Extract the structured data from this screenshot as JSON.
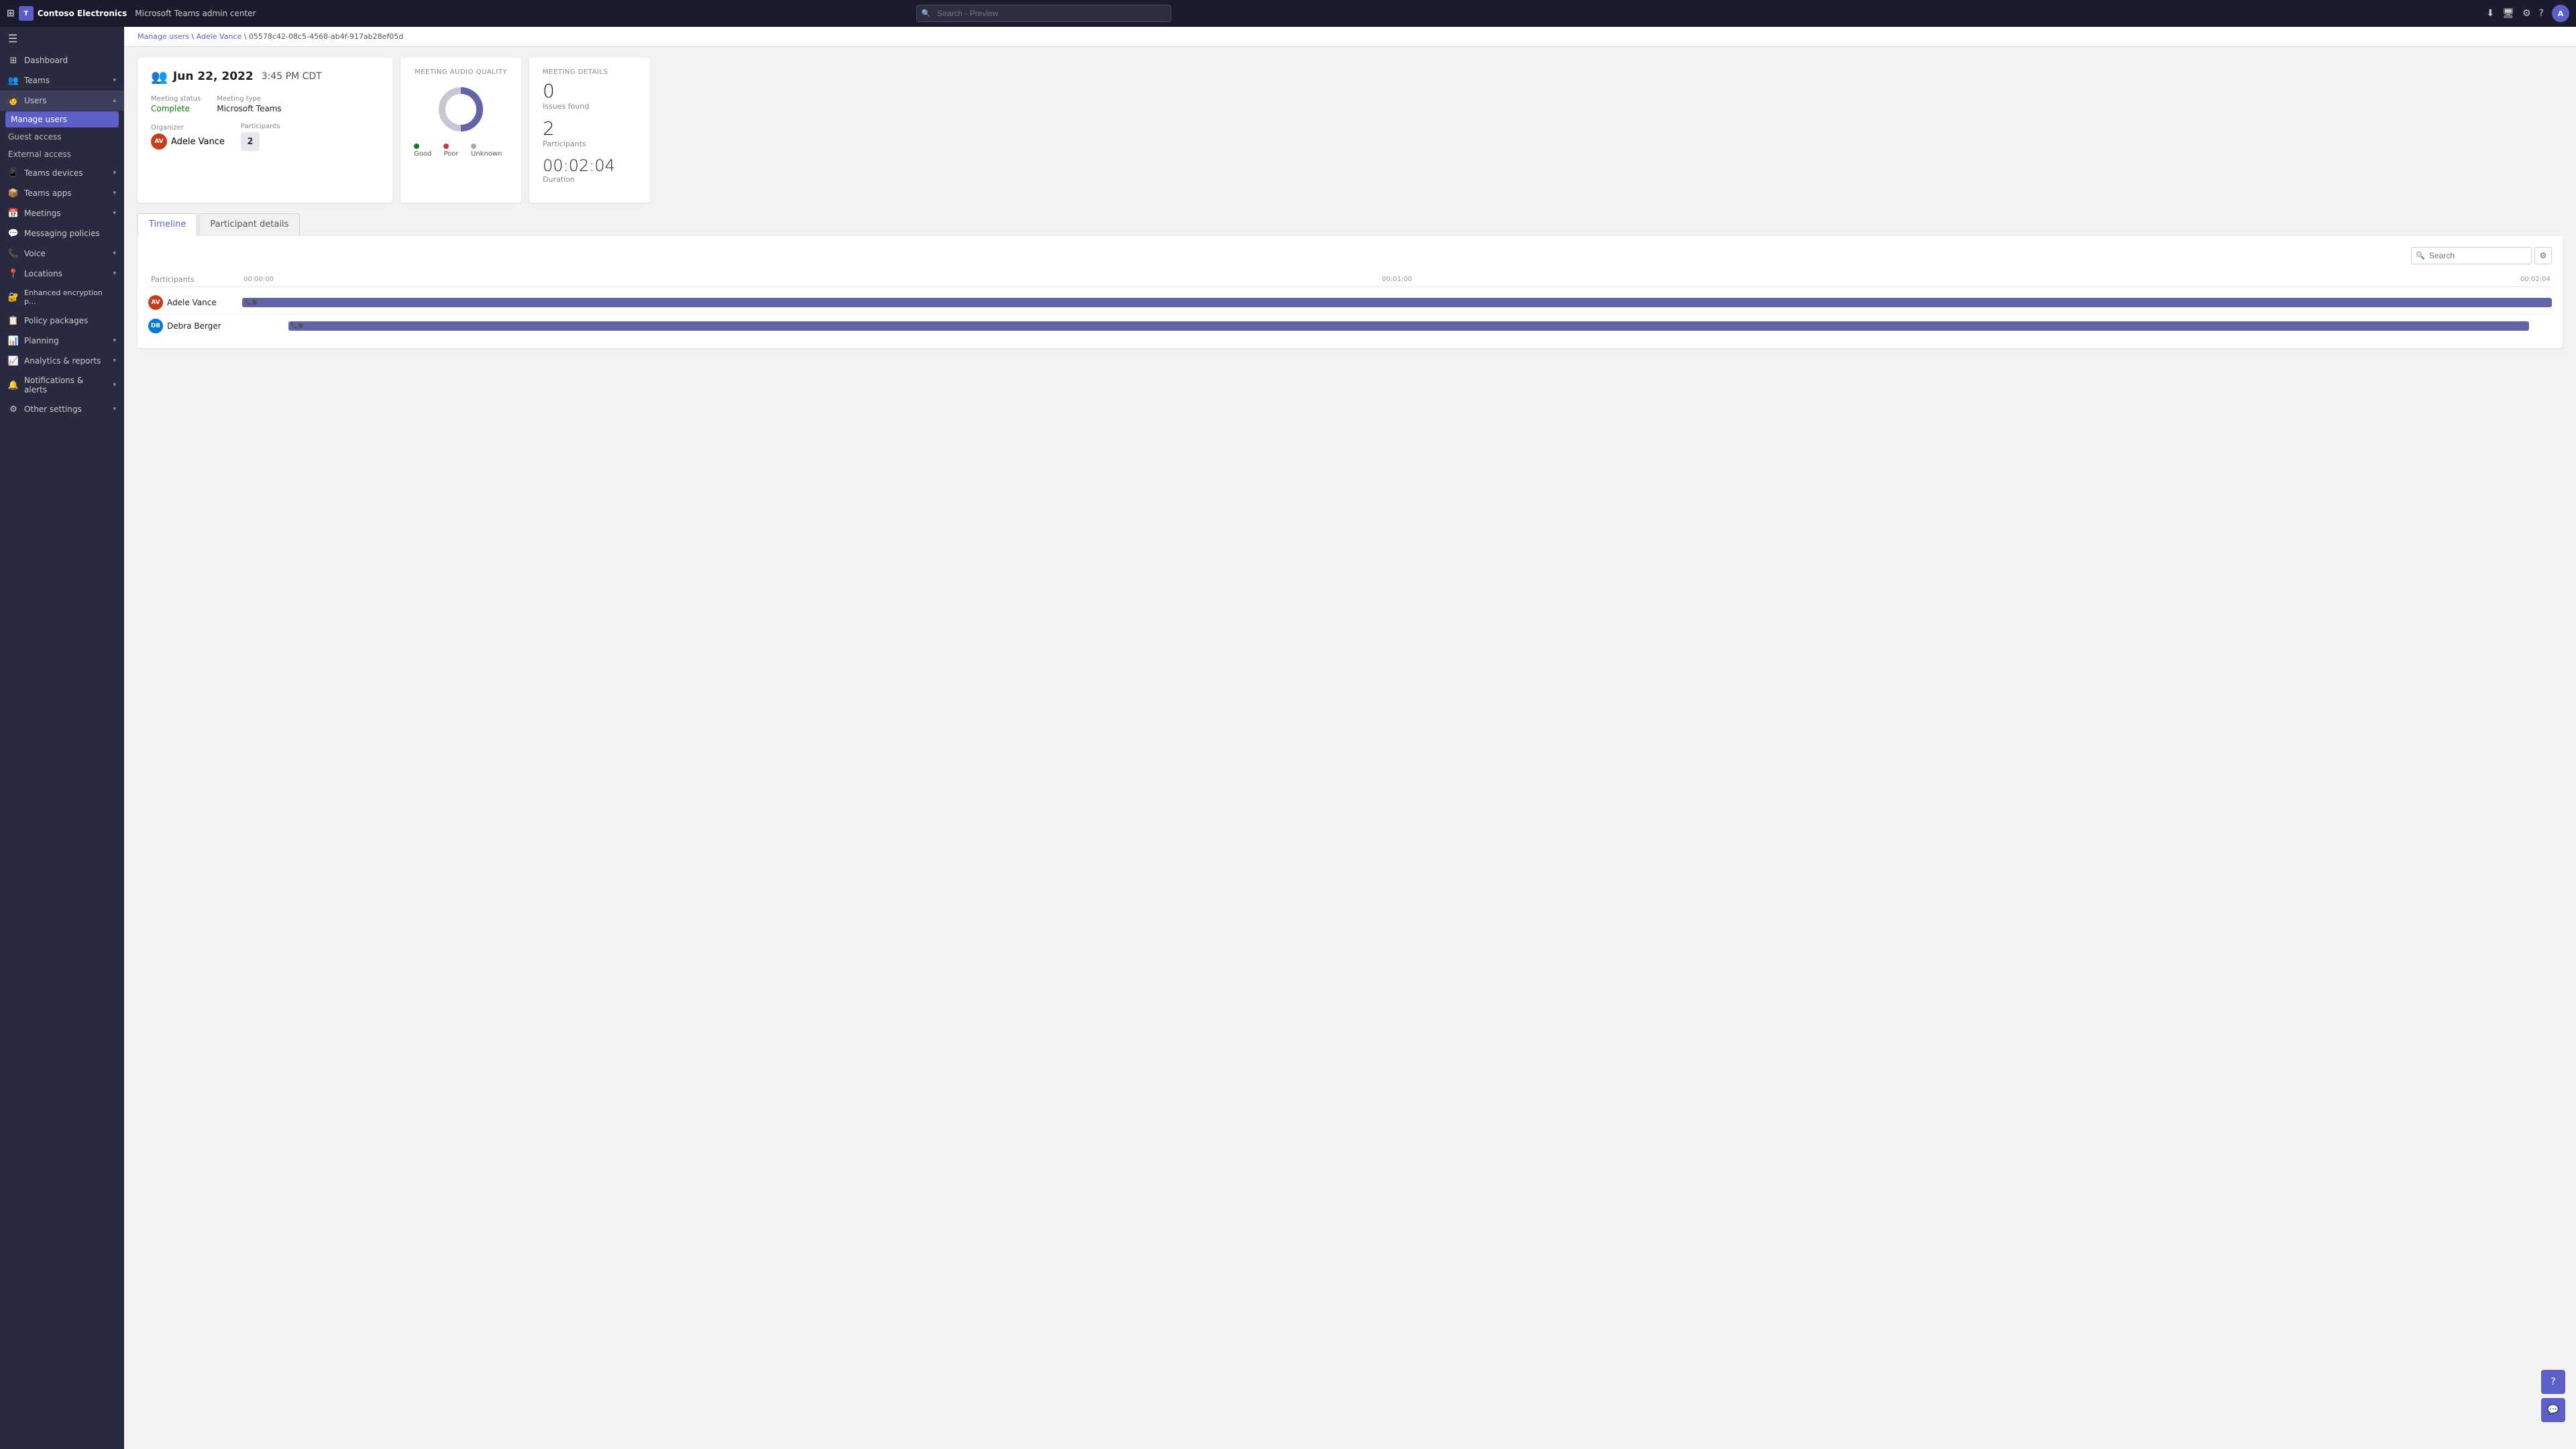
{
  "topbar": {
    "company": "Contoso Electronics",
    "app_name": "Microsoft Teams admin center",
    "search_placeholder": "Search - Preview",
    "avatar_initials": "A"
  },
  "breadcrumb": {
    "parts": [
      "Manage users",
      "Adele Vance",
      "05578c42-08c5-4568-ab4f-917ab28ef05d"
    ]
  },
  "sidebar": {
    "hamburger": "☰",
    "items": [
      {
        "id": "dashboard",
        "label": "Dashboard",
        "icon": "⊞",
        "has_children": false
      },
      {
        "id": "teams",
        "label": "Teams",
        "icon": "👥",
        "has_children": true
      },
      {
        "id": "users",
        "label": "Users",
        "icon": "🧑",
        "has_children": true,
        "expanded": true
      },
      {
        "id": "teams-devices",
        "label": "Teams devices",
        "icon": "📱",
        "has_children": true
      },
      {
        "id": "teams-apps",
        "label": "Teams apps",
        "icon": "📦",
        "has_children": true
      },
      {
        "id": "meetings",
        "label": "Meetings",
        "icon": "📅",
        "has_children": true
      },
      {
        "id": "messaging",
        "label": "Messaging policies",
        "icon": "💬",
        "has_children": false
      },
      {
        "id": "voice",
        "label": "Voice",
        "icon": "📞",
        "has_children": true
      },
      {
        "id": "locations",
        "label": "Locations",
        "icon": "📍",
        "has_children": true
      },
      {
        "id": "encryption",
        "label": "Enhanced encryption p...",
        "icon": "🔐",
        "has_children": false
      },
      {
        "id": "policy",
        "label": "Policy packages",
        "icon": "📋",
        "has_children": false
      },
      {
        "id": "planning",
        "label": "Planning",
        "icon": "📊",
        "has_children": true
      },
      {
        "id": "analytics",
        "label": "Analytics & reports",
        "icon": "📈",
        "has_children": true
      },
      {
        "id": "notifications",
        "label": "Notifications & alerts",
        "icon": "🔔",
        "has_children": true
      },
      {
        "id": "other",
        "label": "Other settings",
        "icon": "⚙️",
        "has_children": true
      }
    ],
    "sub_items": {
      "users": [
        {
          "id": "manage-users",
          "label": "Manage users",
          "active": true
        },
        {
          "id": "guest-access",
          "label": "Guest access"
        },
        {
          "id": "external-access",
          "label": "External access"
        }
      ]
    }
  },
  "meeting_card": {
    "icon": "👥",
    "date": "Jun 22, 2022",
    "time": "3:45 PM CDT",
    "status_label": "Meeting status",
    "status_value": "Complete",
    "type_label": "Meeting type",
    "type_value": "Microsoft Teams",
    "organizer_label": "Organizer",
    "organizer_name": "Adele Vance",
    "organizer_initials": "AV",
    "participants_label": "Participants",
    "participants_count": "2"
  },
  "audio_quality": {
    "title": "MEETING AUDIO QUALITY",
    "legend": [
      {
        "label": "Good",
        "color": "#107c10"
      },
      {
        "label": "Poor",
        "color": "#d13438"
      },
      {
        "label": "Unknown",
        "color": "#aaa"
      }
    ],
    "donut": {
      "good_pct": 50,
      "poor_pct": 0,
      "unknown_pct": 50
    }
  },
  "meeting_details": {
    "title": "MEETING DETAILS",
    "issues_count": "0",
    "issues_label": "Issues found",
    "participants_count": "2",
    "participants_label": "Participants",
    "duration": "00:02:04",
    "duration_label": "Duration"
  },
  "tabs": [
    {
      "id": "timeline",
      "label": "Timeline",
      "active": true
    },
    {
      "id": "participant-details",
      "label": "Participant details",
      "active": false
    }
  ],
  "timeline": {
    "search_placeholder": "Search",
    "participants_col_label": "Participants",
    "time_markers": [
      "00:00:00",
      "00:01:00",
      "00:02:04"
    ],
    "rows": [
      {
        "name": "Adele Vance",
        "initials": "AV",
        "avatar_color": "#c43e1c",
        "bar_start_pct": 0,
        "bar_width_pct": 100
      },
      {
        "name": "Debra Berger",
        "initials": "DB",
        "avatar_color": "#0078d4",
        "bar_start_pct": 2,
        "bar_width_pct": 97
      }
    ]
  },
  "floating_btns": [
    {
      "id": "help-btn",
      "icon": "?"
    },
    {
      "id": "chat-btn",
      "icon": "💬"
    }
  ]
}
